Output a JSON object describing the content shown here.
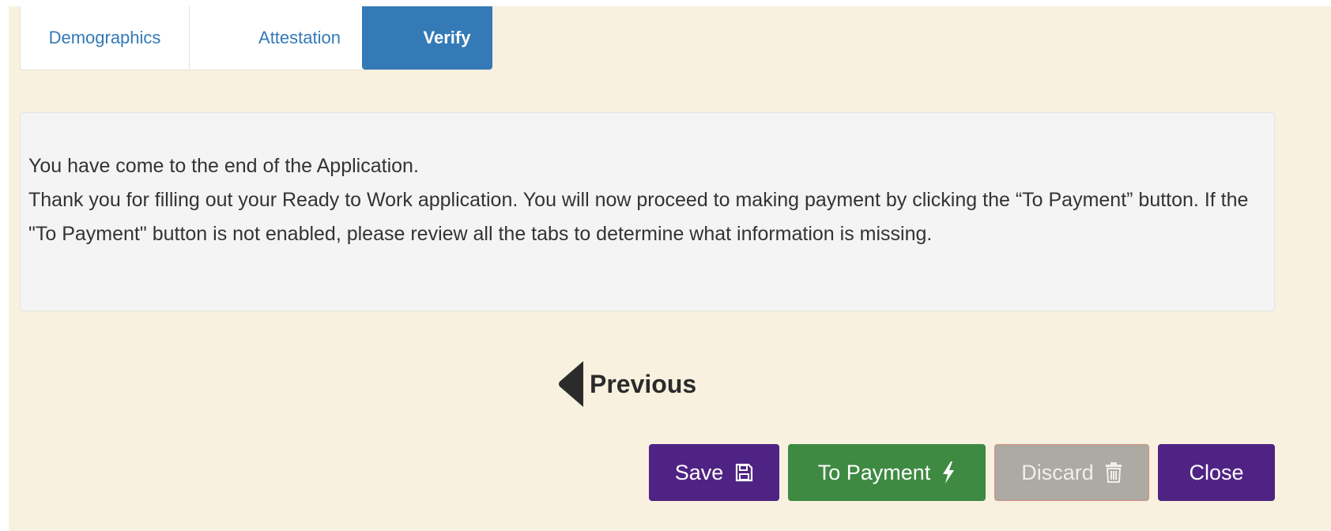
{
  "tabs": [
    {
      "label": "Demographics",
      "active": false
    },
    {
      "label": "Attestation",
      "active": false
    },
    {
      "label": "Verify",
      "active": true
    }
  ],
  "message": {
    "line1": "You have come to the end of the Application.",
    "line2": "Thank you for filling out your Ready to Work application. You will now proceed to making payment by clicking the “To Payment” button. If the \"To Payment\" button is not enabled, please review all the tabs to determine what information is missing."
  },
  "navigation": {
    "previous_label": "Previous",
    "previous_icon": "triangle-left-icon"
  },
  "actions": {
    "save_label": "Save",
    "save_icon": "floppy-disk-icon",
    "payment_label": "To Payment",
    "payment_icon": "lightning-bolt-icon",
    "discard_label": "Discard",
    "discard_icon": "trash-icon",
    "close_label": "Close"
  },
  "colors": {
    "page_background": "#f8f1df",
    "tab_active": "#337ab7",
    "tab_text": "#337ab7",
    "save_close": "#4f2383",
    "payment": "#3e8a42",
    "discard": "#adaaa3"
  }
}
